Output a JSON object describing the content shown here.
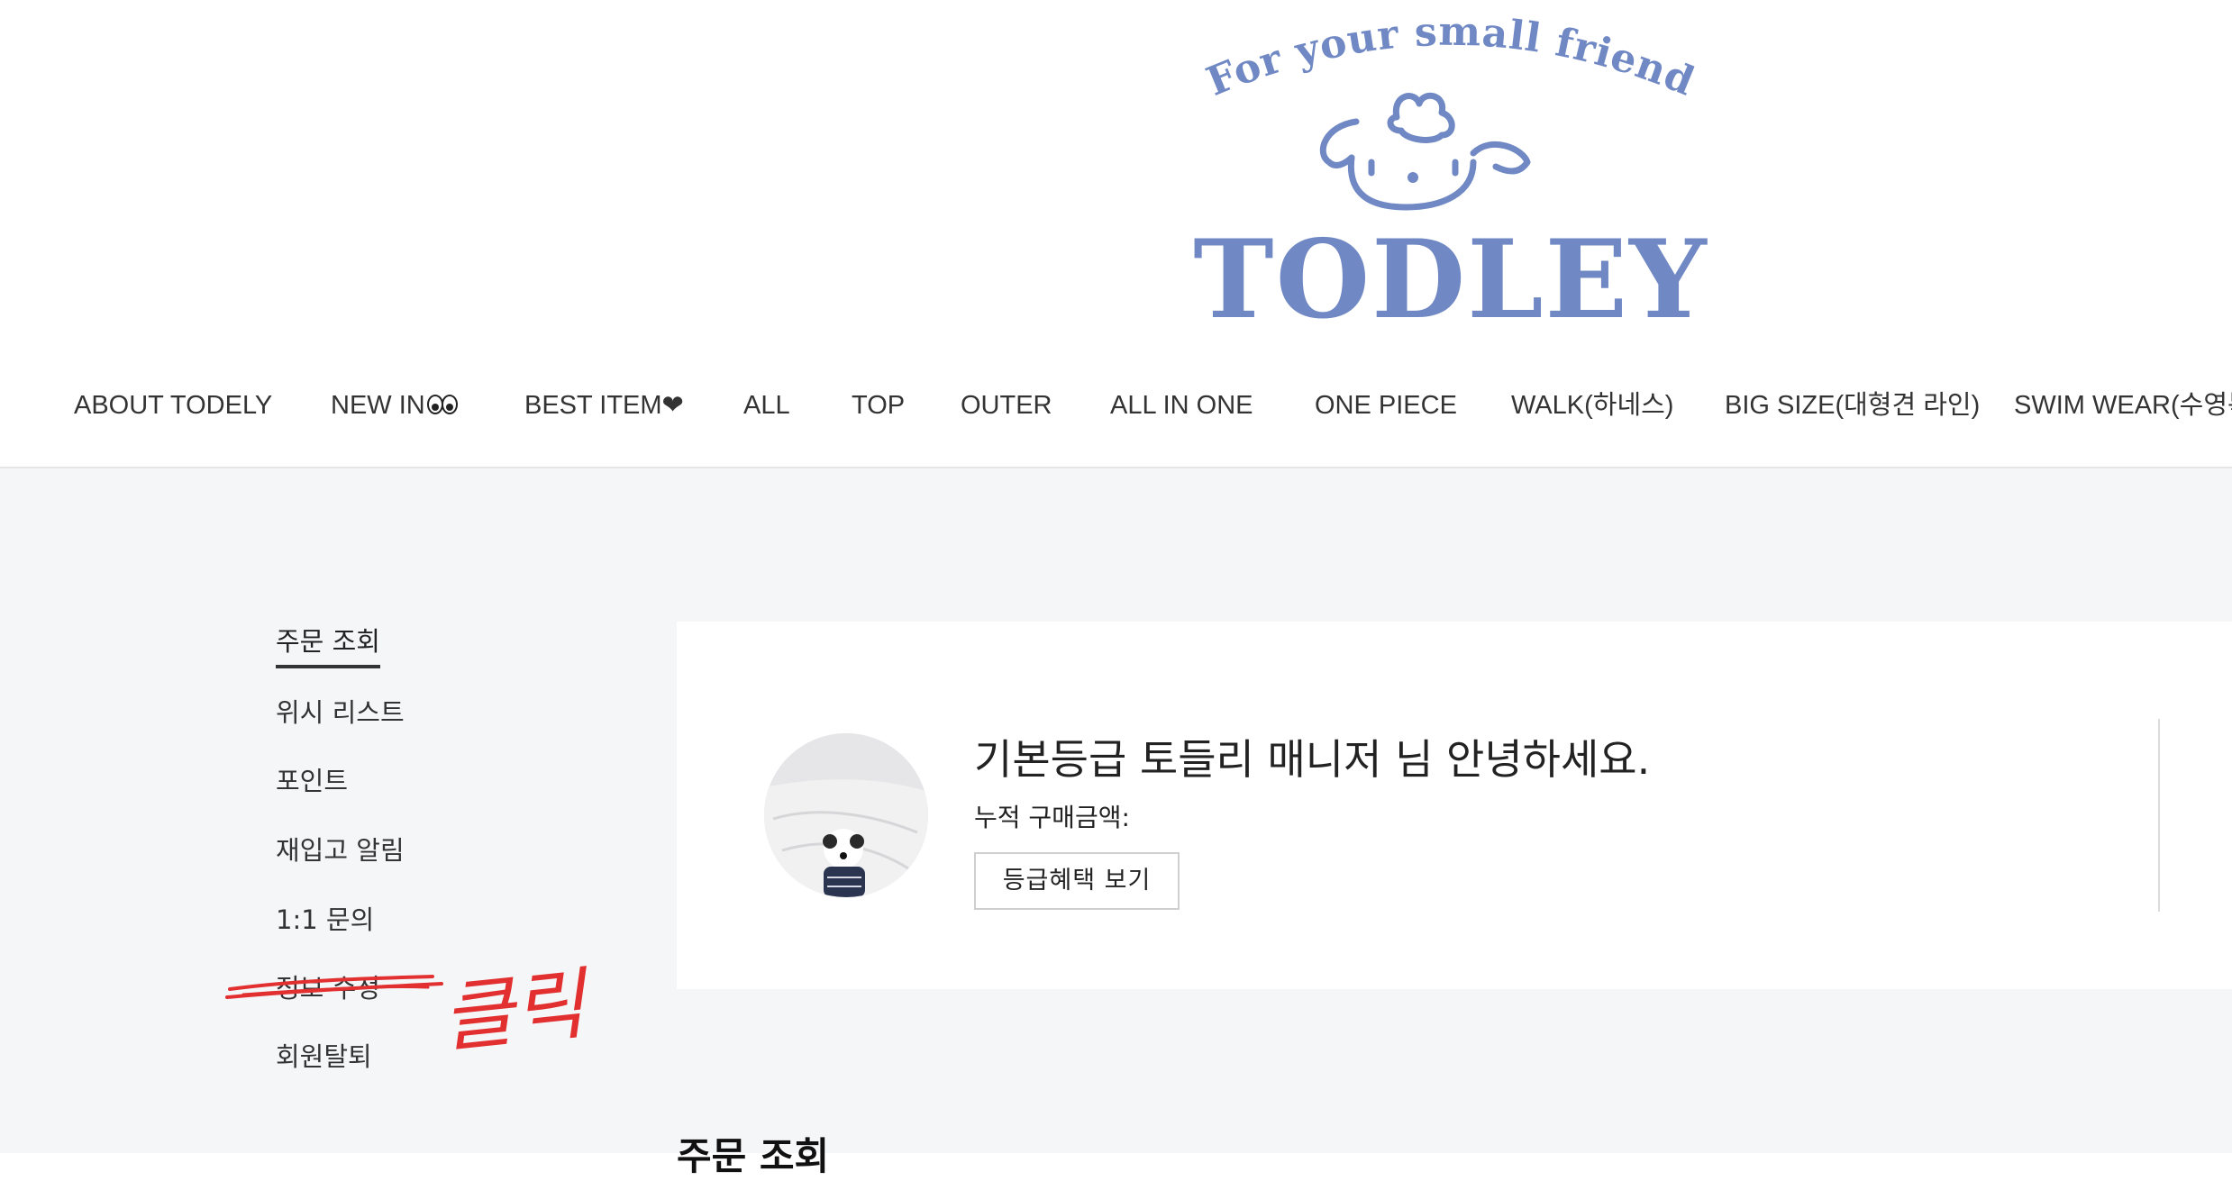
{
  "brand": {
    "tagline": "For your small friend",
    "name": "TODLEY",
    "color": "#7088c4"
  },
  "nav": {
    "items": [
      {
        "label": "ABOUT TODELY"
      },
      {
        "label": "NEW IN"
      },
      {
        "label": "BEST ITEM❤"
      },
      {
        "label": "ALL"
      },
      {
        "label": "TOP"
      },
      {
        "label": "OUTER"
      },
      {
        "label": "ALL IN ONE"
      },
      {
        "label": "ONE PIECE"
      },
      {
        "label": "WALK(하네스)"
      },
      {
        "label": "BIG SIZE(대형견 라인)"
      },
      {
        "label": "SWIM WEAR(수영복"
      }
    ]
  },
  "side_menu": {
    "items": [
      {
        "label": "주문 조회",
        "active": true
      },
      {
        "label": "위시 리스트"
      },
      {
        "label": "포인트"
      },
      {
        "label": "재입고 알림"
      },
      {
        "label": "1:1 문의"
      },
      {
        "label": "정보 수정"
      },
      {
        "label": "회원탈퇴"
      }
    ]
  },
  "annotation": {
    "text": "클릭",
    "color": "#e23030"
  },
  "profile": {
    "greeting": "기본등급 토들리 매니저 님 안녕하세요.",
    "purchase_label": "누적 구매금액:",
    "grade_button": "등급혜택 보기"
  },
  "section": {
    "title": "주문 조회"
  },
  "colors": {
    "content_bg": "#f5f6f8",
    "card_bg": "#ffffff",
    "text": "#222222"
  }
}
